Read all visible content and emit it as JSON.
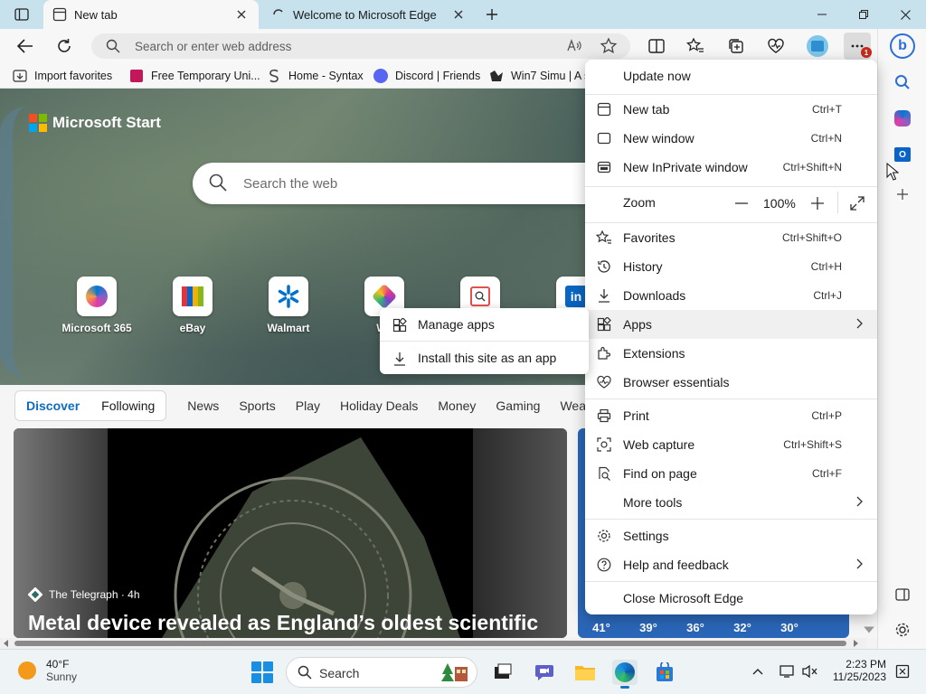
{
  "tabs": [
    {
      "title": "New tab",
      "active": true
    },
    {
      "title": "Welcome to Microsoft Edge",
      "active": false
    }
  ],
  "toolbar": {
    "address_placeholder": "Search or enter web address"
  },
  "favorites": [
    {
      "label": "Import favorites",
      "icon": "import-icon"
    },
    {
      "label": "Free Temporary Uni...",
      "icon": "fav-site-icon"
    },
    {
      "label": "Home - Syntax",
      "icon": "syntax-icon"
    },
    {
      "label": "Discord | Friends",
      "icon": "discord-icon"
    },
    {
      "label": "Win7 Simu | A s",
      "icon": "win7-icon"
    }
  ],
  "page": {
    "brand": "Microsoft Start",
    "search_placeholder": "Search the web",
    "tiles": [
      {
        "label": "Microsoft 365"
      },
      {
        "label": "eBay"
      },
      {
        "label": "Walmart"
      },
      {
        "label": "Wa"
      }
    ],
    "feed_pill": [
      "Discover",
      "Following"
    ],
    "feed_tabs": [
      "News",
      "Sports",
      "Play",
      "Holiday Deals",
      "Money",
      "Gaming",
      "Wea"
    ],
    "card": {
      "source": "The Telegraph · 4h",
      "headline": "Metal device revealed as England’s oldest scientific"
    },
    "temps": [
      "41°",
      "39°",
      "36°",
      "32°",
      "30°"
    ]
  },
  "menu": {
    "items": [
      {
        "label": "Update now",
        "shortcut": "",
        "icon": ""
      },
      {
        "label": "New tab",
        "shortcut": "Ctrl+T",
        "icon": "new-tab-icon"
      },
      {
        "label": "New window",
        "shortcut": "Ctrl+N",
        "icon": "new-window-icon"
      },
      {
        "label": "New InPrivate window",
        "shortcut": "Ctrl+Shift+N",
        "icon": "inprivate-icon"
      },
      {
        "label": "Zoom",
        "shortcut": "",
        "icon": ""
      },
      {
        "label": "Favorites",
        "shortcut": "Ctrl+Shift+O",
        "icon": "favorites-icon"
      },
      {
        "label": "History",
        "shortcut": "Ctrl+H",
        "icon": "history-icon"
      },
      {
        "label": "Downloads",
        "shortcut": "Ctrl+J",
        "icon": "download-icon"
      },
      {
        "label": "Apps",
        "shortcut": "",
        "icon": "apps-icon"
      },
      {
        "label": "Extensions",
        "shortcut": "",
        "icon": "extensions-icon"
      },
      {
        "label": "Browser essentials",
        "shortcut": "",
        "icon": "heart-pulse-icon"
      },
      {
        "label": "Print",
        "shortcut": "Ctrl+P",
        "icon": "print-icon"
      },
      {
        "label": "Web capture",
        "shortcut": "Ctrl+Shift+S",
        "icon": "web-capture-icon"
      },
      {
        "label": "Find on page",
        "shortcut": "Ctrl+F",
        "icon": "find-icon"
      },
      {
        "label": "More tools",
        "shortcut": "",
        "icon": ""
      },
      {
        "label": "Settings",
        "shortcut": "",
        "icon": "gear-icon"
      },
      {
        "label": "Help and feedback",
        "shortcut": "",
        "icon": "help-icon"
      },
      {
        "label": "Close Microsoft Edge",
        "shortcut": "",
        "icon": ""
      }
    ],
    "zoom_value": "100%"
  },
  "submenu": {
    "items": [
      {
        "label": "Manage apps"
      },
      {
        "label": "Install this site as an app"
      }
    ]
  },
  "taskbar": {
    "weather_temp": "40°F",
    "weather_desc": "Sunny",
    "search_label": "Search",
    "time": "2:23 PM",
    "date": "11/25/2023"
  },
  "badge_count": "1"
}
